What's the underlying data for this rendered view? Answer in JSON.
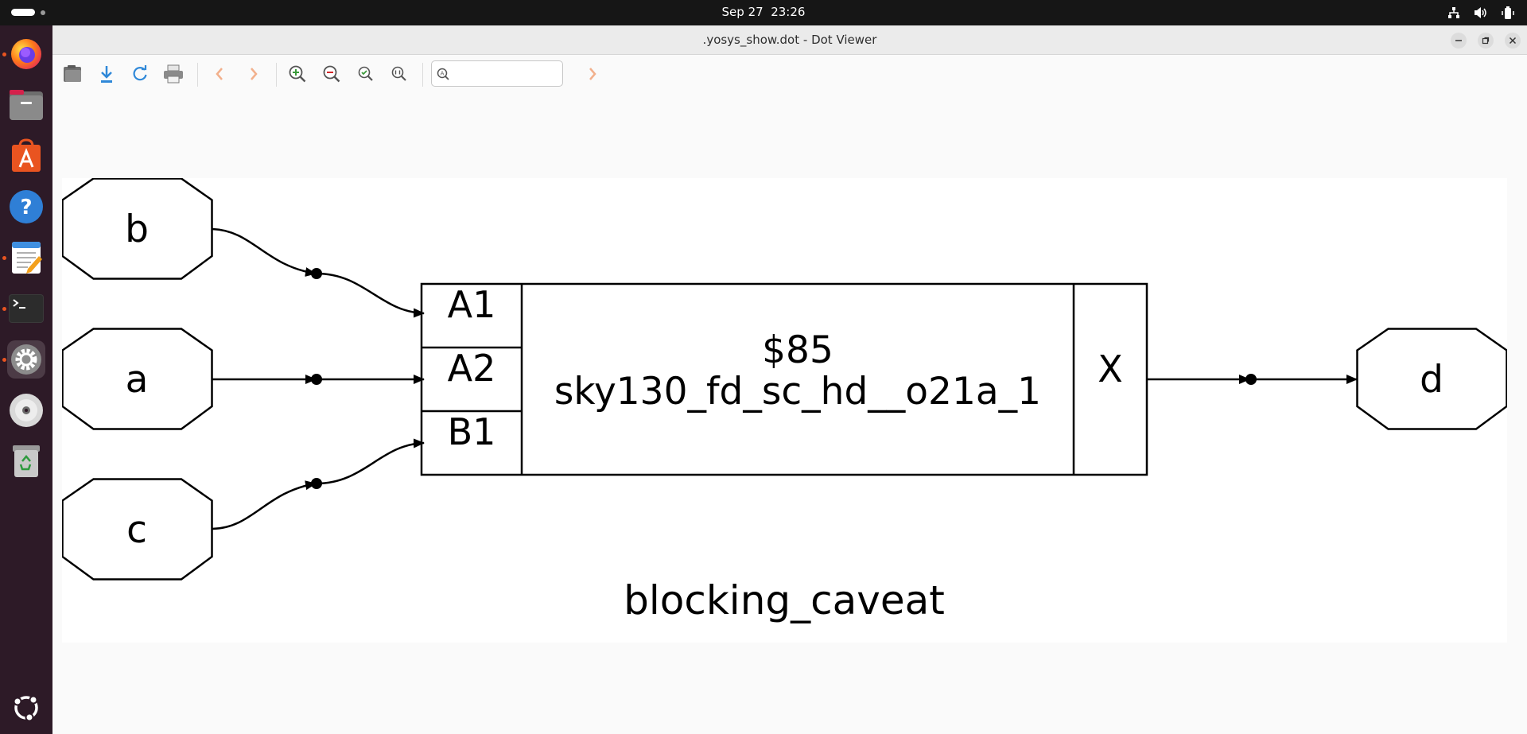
{
  "topbar": {
    "date": "Sep 27",
    "time": "23:26",
    "tray_icons": [
      "network-icon",
      "volume-icon",
      "battery-icon"
    ]
  },
  "dock": {
    "items": [
      {
        "name": "firefox",
        "icon": "firefox-icon",
        "running": true
      },
      {
        "name": "files",
        "icon": "files-icon",
        "running": false
      },
      {
        "name": "app-center",
        "icon": "app-center-icon",
        "running": false
      },
      {
        "name": "help",
        "icon": "help-icon",
        "running": false
      },
      {
        "name": "text-editor",
        "icon": "text-editor-icon",
        "running": true
      },
      {
        "name": "terminal",
        "icon": "terminal-icon",
        "running": true
      },
      {
        "name": "settings",
        "icon": "settings-icon",
        "running": true
      },
      {
        "name": "disc",
        "icon": "disc-icon",
        "running": false
      },
      {
        "name": "trash",
        "icon": "trash-icon",
        "running": false
      },
      {
        "name": "show-apps",
        "icon": "ubuntu-logo-icon",
        "running": false
      }
    ]
  },
  "window": {
    "title": ".yosys_show.dot - Dot Viewer"
  },
  "toolbar": {
    "search_value": "",
    "buttons": [
      "open",
      "save",
      "reload",
      "print",
      "back",
      "forward",
      "zoom-in",
      "zoom-out",
      "zoom-fit",
      "zoom-100",
      "find-next"
    ]
  },
  "graph": {
    "caption": "blocking_caveat",
    "inputs": [
      "b",
      "a",
      "c"
    ],
    "output": "d",
    "cell": {
      "id": "$85",
      "type": "sky130_fd_sc_hd__o21a_1",
      "in_ports": [
        "A1",
        "A2",
        "B1"
      ],
      "out_port": "X"
    }
  },
  "colors": {
    "topbar": "#161616",
    "dock": "#2d1a27",
    "accent": "#e95420",
    "canvas": "#ffffff"
  }
}
